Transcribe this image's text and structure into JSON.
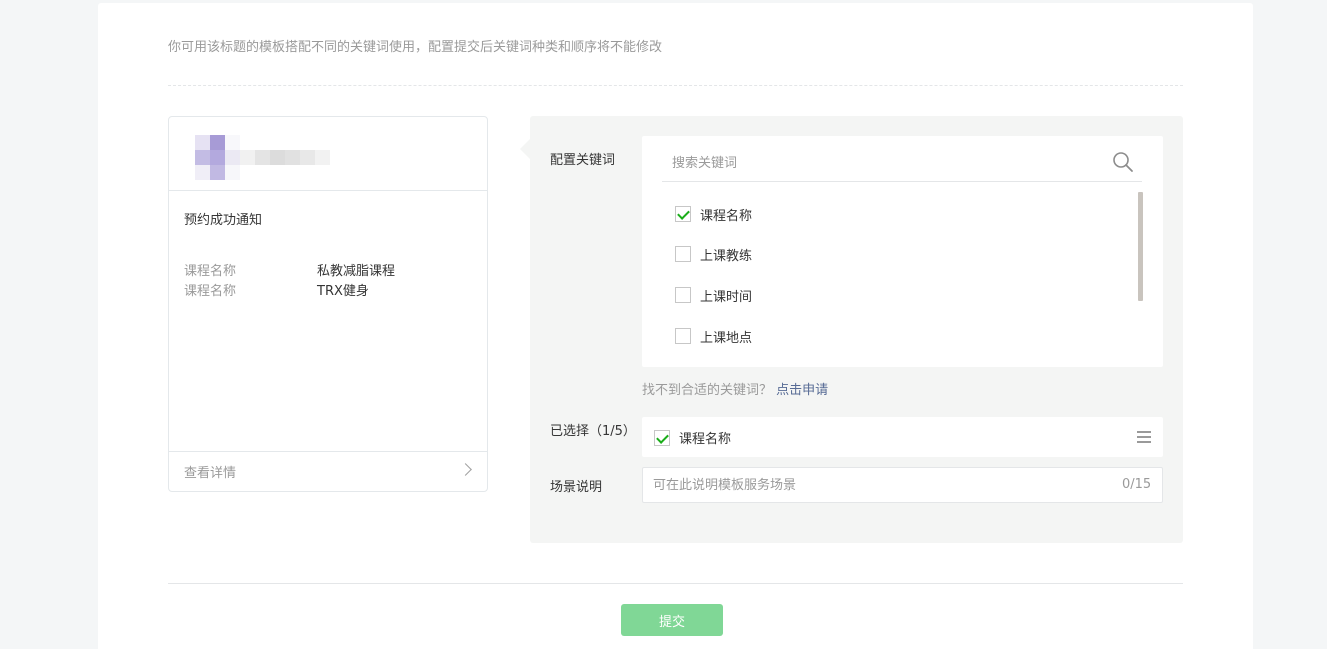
{
  "notice": "你可用该标题的模板搭配不同的关键词使用，配置提交后关键词种类和顺序将不能修改",
  "preview": {
    "title": "预约成功通知",
    "fields": [
      {
        "key": "课程名称",
        "value": "私教减脂课程"
      },
      {
        "key": "课程名称",
        "value": "TRX健身"
      }
    ],
    "detail_label": "查看详情"
  },
  "config": {
    "keywords_label": "配置关键词",
    "search_placeholder": "搜索关键词",
    "keywords": [
      {
        "label": "课程名称",
        "checked": true
      },
      {
        "label": "上课教练",
        "checked": false
      },
      {
        "label": "上课时间",
        "checked": false
      },
      {
        "label": "上课地点",
        "checked": false
      }
    ],
    "hint": "找不到合适的关键词？",
    "apply_link": "点击申请",
    "selected_label": "已选择（1/5）",
    "selected_items": [
      {
        "label": "课程名称"
      }
    ],
    "scene_label": "场景说明",
    "scene_placeholder": "可在此说明模板服务场景",
    "scene_counter": "0/15"
  },
  "submit_label": "提交",
  "colors": {
    "accent_green": "#1aad19",
    "submit_disabled": "#80d796",
    "link": "#576b95"
  }
}
